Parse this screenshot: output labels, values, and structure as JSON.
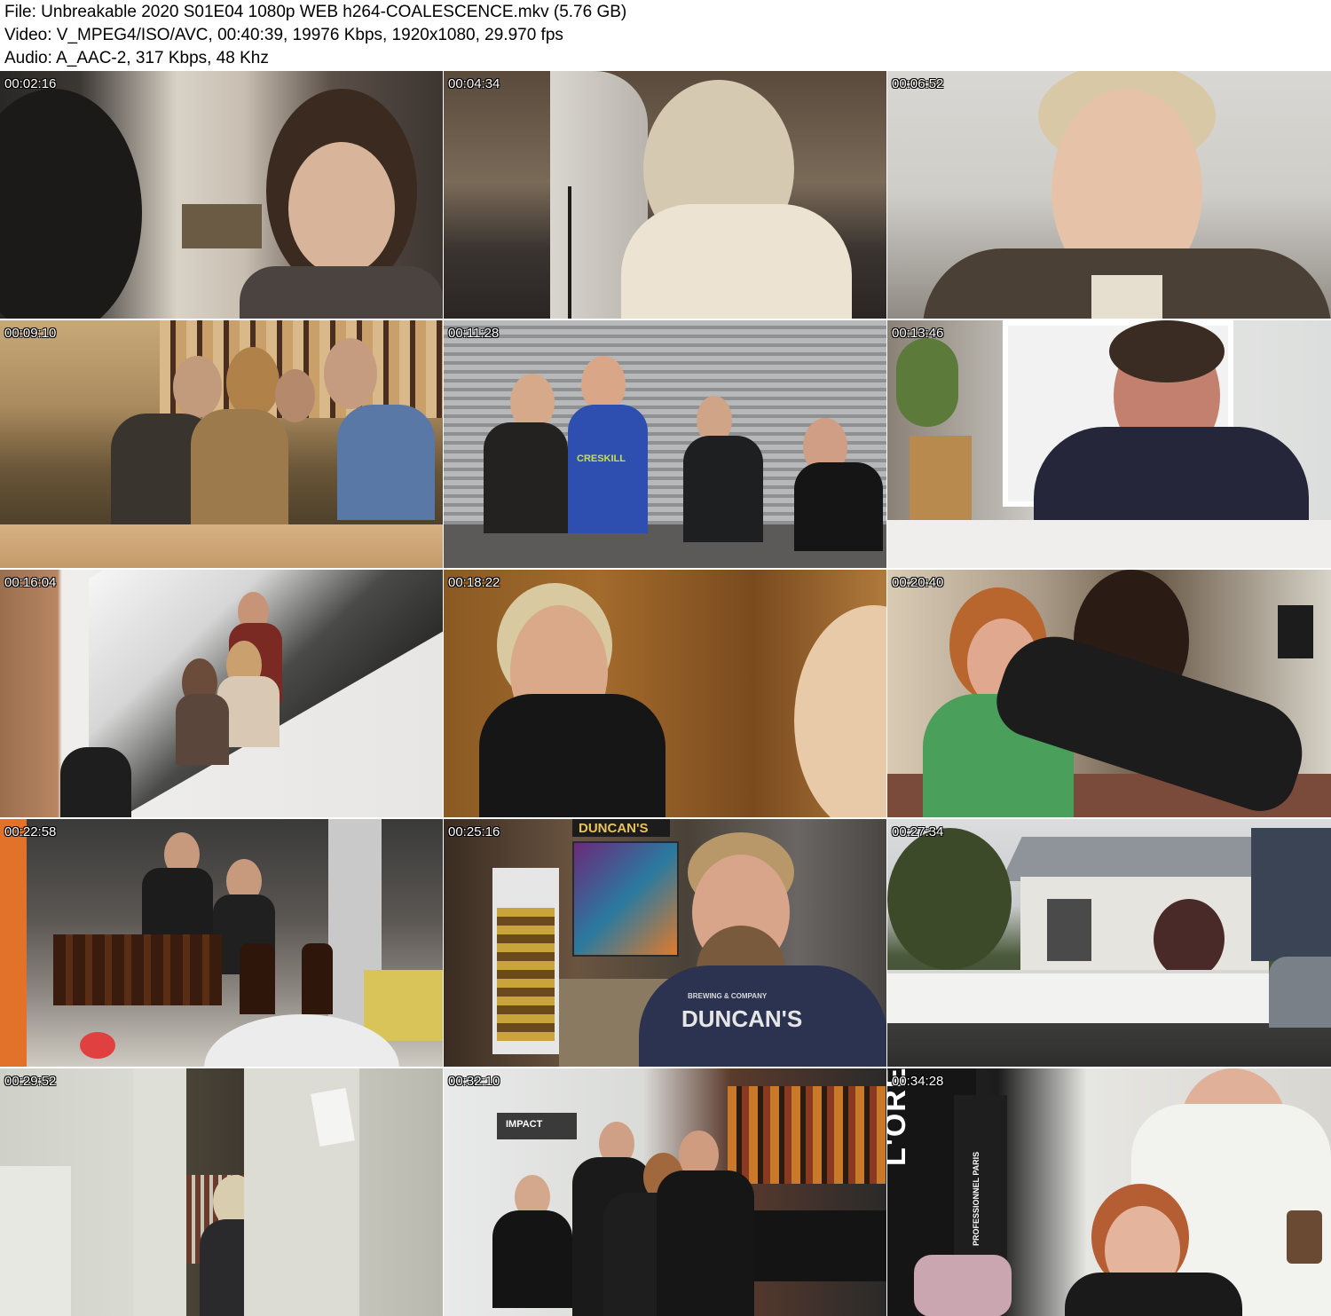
{
  "header": {
    "file_line": "File: Unbreakable 2020 S01E04 1080p WEB h264-COALESCENCE.mkv (5.76 GB)",
    "video_line": "Video: V_MPEG4/ISO/AVC, 00:40:39, 19976 Kbps, 1920x1080, 29.970 fps",
    "audio_line": "Audio: A_AAC-2, 317 Kbps, 48 Khz"
  },
  "thumbnails": [
    {
      "timestamp": "00:02:16"
    },
    {
      "timestamp": "00:04:34"
    },
    {
      "timestamp": "00:06:52"
    },
    {
      "timestamp": "00:09:10"
    },
    {
      "timestamp": "00:11:28",
      "hoodie_text": "CRESKILL"
    },
    {
      "timestamp": "00:13:46"
    },
    {
      "timestamp": "00:16:04"
    },
    {
      "timestamp": "00:18:22"
    },
    {
      "timestamp": "00:20:40"
    },
    {
      "timestamp": "00:22:58"
    },
    {
      "timestamp": "00:25:16",
      "sign_text": "DUNCAN'S",
      "shirt_text": "DUNCAN'S",
      "shirt_small": "BREWING & COMPANY"
    },
    {
      "timestamp": "00:27:34"
    },
    {
      "timestamp": "00:29:52"
    },
    {
      "timestamp": "00:32:10",
      "sign_text": "IMPACT"
    },
    {
      "timestamp": "00:34:28",
      "banner_text": "L'ORÉAL",
      "banner_sub": "PROFESSIONNEL PARIS"
    }
  ]
}
